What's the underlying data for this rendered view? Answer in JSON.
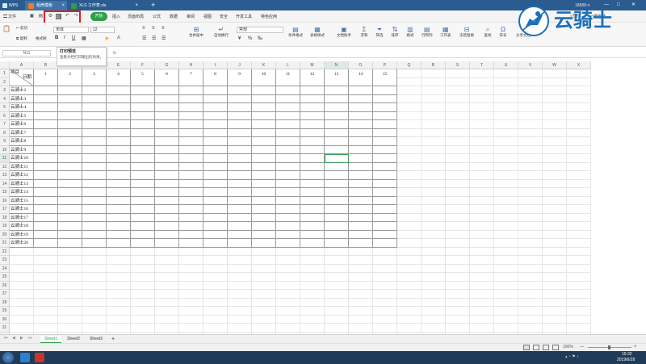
{
  "colors": {
    "title_bar": "#2b5c8f",
    "accent_green": "#2e9e4a",
    "highlight_red": "#e02020",
    "selected_cell": "#3aa05a",
    "taskbar": "#1f3b57"
  },
  "title_bar": {
    "app_label": "WPS",
    "tabs": [
      {
        "label": "稻壳模板",
        "icon": "docer-icon",
        "active": true
      },
      {
        "label": "XLS 工作表.xls",
        "icon": "spreadsheet-icon",
        "active": false
      }
    ],
    "new_tab_symbol": "+",
    "user": "18888-n",
    "account_menu": "一键安装",
    "window_controls": [
      "—",
      "□",
      "✕"
    ]
  },
  "menu": {
    "file_label": "文件",
    "active_tab": "开始",
    "tabs": [
      "插入",
      "页面布局",
      "公式",
      "数据",
      "审阅",
      "视图",
      "安全",
      "开发工具",
      "特色应用"
    ],
    "search_placeholder": "查找"
  },
  "tooltip": {
    "title": "打印预览",
    "body": "查看文档打印输出的效果。"
  },
  "ribbon": {
    "clipboard": {
      "cut": "剪切",
      "copy": "复制",
      "format_painter": "格式刷",
      "paste": "粘贴"
    },
    "font_name": "宋体",
    "font_size": "12",
    "number_format": "常规",
    "buttons": [
      "合并居中",
      "自动换行",
      "条件格式",
      "表格样式",
      "文档助手",
      "求和",
      "筛选",
      "排序",
      "格式",
      "行和列",
      "工作表",
      "冻结窗格",
      "查找",
      "符号",
      "分享文档"
    ]
  },
  "formula_bar": {
    "name_box": "N11",
    "fx": "fx",
    "content": ""
  },
  "grid": {
    "columns": [
      "A",
      "B",
      "C",
      "D",
      "E",
      "F",
      "G",
      "H",
      "I",
      "J",
      "K",
      "L",
      "M",
      "N",
      "O",
      "P",
      "Q",
      "R",
      "S",
      "T",
      "U",
      "V",
      "W",
      "X"
    ],
    "rows": [
      "1",
      "2",
      "3",
      "4",
      "5",
      "6",
      "7",
      "8",
      "9",
      "10",
      "11",
      "12",
      "13",
      "14",
      "15",
      "16",
      "17",
      "18",
      "19",
      "20",
      "21",
      "22",
      "23",
      "24",
      "25",
      "26",
      "27",
      "28",
      "29",
      "30",
      "31",
      "32",
      "33",
      "34"
    ],
    "header_cell": {
      "top": "项目",
      "bottom": "日期"
    },
    "day_numbers": [
      "1",
      "2",
      "3",
      "4",
      "5",
      "6",
      "7",
      "8",
      "9",
      "10",
      "11",
      "12",
      "13",
      "14",
      "15"
    ],
    "row_labels": [
      "云骑士1",
      "云骑士2",
      "云骑士3",
      "云骑士4",
      "云骑士5",
      "云骑士6",
      "云骑士7",
      "云骑士8",
      "云骑士9",
      "云骑士10",
      "云骑士11",
      "云骑士12",
      "云骑士13",
      "云骑士14",
      "云骑士15",
      "云骑士16",
      "云骑士17",
      "云骑士18",
      "云骑士19",
      "云骑士20"
    ],
    "selected_cell": "N11"
  },
  "sheets": {
    "tabs": [
      "Sheet1",
      "Sheet2",
      "Sheet3"
    ],
    "active": "Sheet1",
    "add_symbol": "+"
  },
  "status": {
    "zoom": "100%",
    "zoom_minus": "—",
    "zoom_plus": "+"
  },
  "taskbar": {
    "time": "15:32",
    "date": "2019/6/28"
  },
  "watermark": {
    "text": "云骑士"
  }
}
